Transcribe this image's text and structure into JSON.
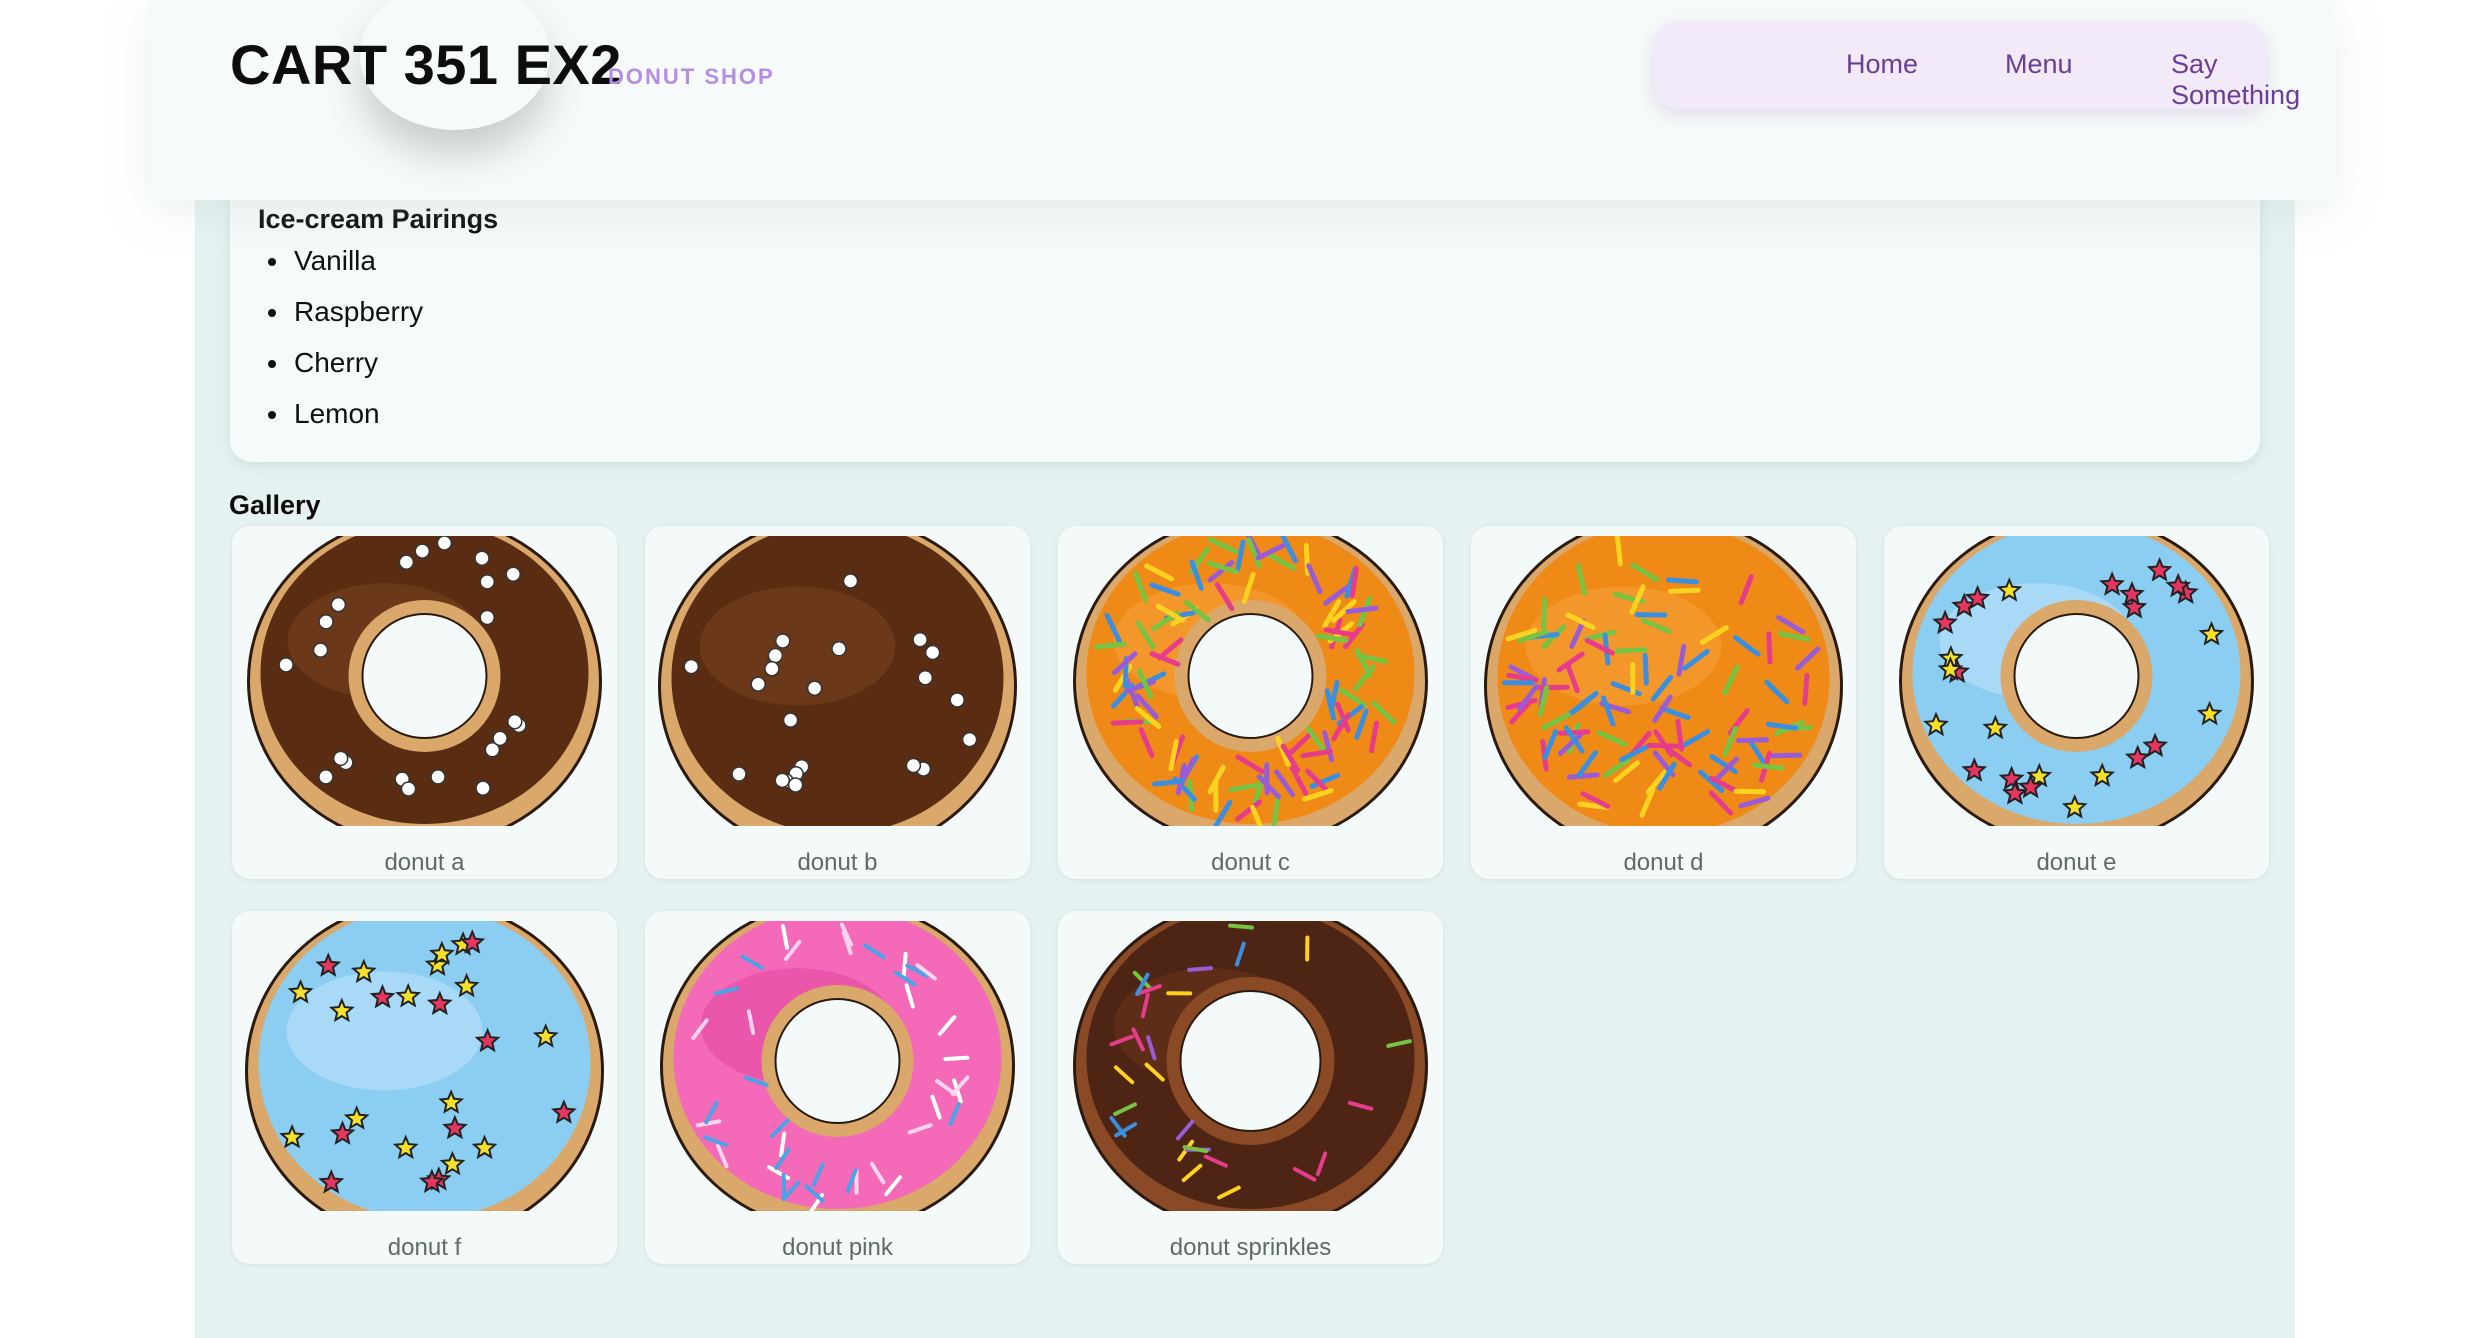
{
  "header": {
    "title": "CART 351 EX2",
    "subtitle": "DONUT SHOP",
    "nav": [
      "Home",
      "Menu",
      "Say Something"
    ]
  },
  "pairings": {
    "heading": "Ice-cream Pairings",
    "items": [
      "Vanilla",
      "Raspberry",
      "Cherry",
      "Lemon"
    ]
  },
  "gallery": {
    "heading": "Gallery",
    "items": [
      {
        "caption": "donut a",
        "style": "chocolate-white-dots"
      },
      {
        "caption": "donut b",
        "style": "chocolate-white-dots-full"
      },
      {
        "caption": "donut c",
        "style": "orange-sprinkles"
      },
      {
        "caption": "donut d",
        "style": "orange-sprinkles-full"
      },
      {
        "caption": "donut e",
        "style": "blue-stars"
      },
      {
        "caption": "donut f",
        "style": "blue-stars-full"
      },
      {
        "caption": "donut pink",
        "style": "pink-sprinkles"
      },
      {
        "caption": "donut sprinkles",
        "style": "chocolate-sprinkles"
      }
    ]
  },
  "colors": {
    "page_bg": "#e6f2f1",
    "card_bg": "#f4f9f9",
    "nav_bg": "#f2eaf8",
    "nav_text": "#6a3d98",
    "subtitle": "#b48ee6"
  }
}
